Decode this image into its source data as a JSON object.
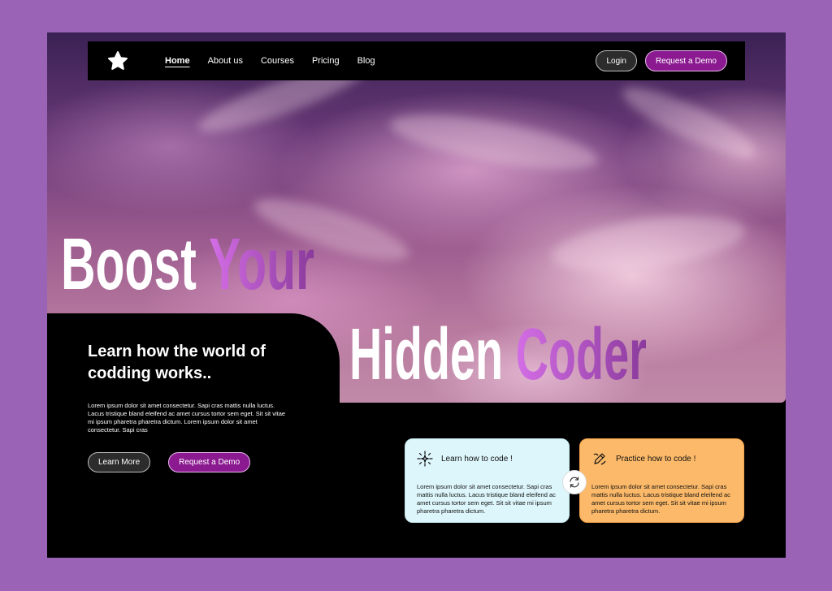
{
  "nav": {
    "items": [
      {
        "label": "Home",
        "active": true
      },
      {
        "label": "About us"
      },
      {
        "label": "Courses"
      },
      {
        "label": "Pricing"
      },
      {
        "label": "Blog"
      }
    ],
    "login_label": "Login",
    "demo_label": "Request a Demo"
  },
  "hero": {
    "line1_word1": "Boost",
    "line1_word2": "Your",
    "line2_word1": "Hidden",
    "line2_word2": "Coder",
    "subheading": "Learn how the world of codding works..",
    "body": "Lorem ipsum dolor sit amet consectetur. Sapi cras mattis nulla luctus. Lacus tristique bland eleifend ac amet cursus tortor sem eget. Sit sit vitae mi ipsum pharetra pharetra dictum. Lorem ipsum dolor sit amet consectetur. Sapi cras",
    "learn_more_label": "Learn More",
    "demo_label": "Request a Demo"
  },
  "cards": [
    {
      "title": "Learn how to code !",
      "icon": "sparkle-icon",
      "text": "Lorem ipsum dolor sit amet consectetur. Sapi cras mattis nulla luctus. Lacus tristique bland eleifend ac amet cursus tortor sem eget. Sit sit vitae mi ipsum pharetra pharetra dictum."
    },
    {
      "title": "Practice how to code !",
      "icon": "pencil-icon",
      "text": "Lorem ipsum dolor sit amet consectetur. Sapi cras mattis nulla luctus. Lacus tristique bland eleifend ac amet cursus tortor sem eget. Sit sit vitae mi ipsum pharetra pharetra dictum."
    }
  ],
  "colors": {
    "background": "#9b63b5",
    "accent": "#8b1a91",
    "card_blue": "#ddf6fb",
    "card_orange": "#fbb969"
  }
}
